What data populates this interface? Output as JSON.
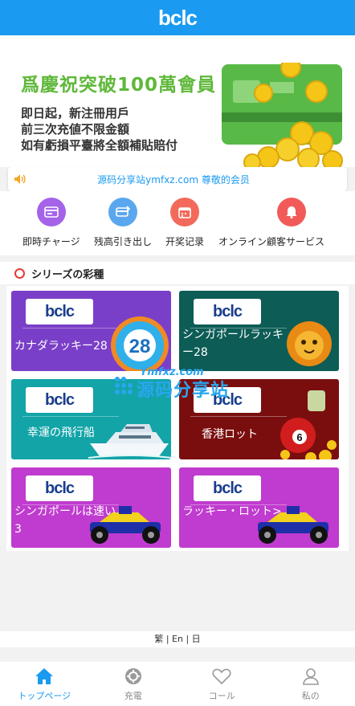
{
  "header": {
    "logo_text": "bclc"
  },
  "banner": {
    "title": "爲慶祝突破100萬會員",
    "lines": [
      "即日起，新注冊用戶",
      "前三次充値不限金額",
      "如有虧損平臺將全額補貼賠付"
    ]
  },
  "notice": {
    "text": "源码分享站ymfxz.com 尊敬的会员",
    "icon": "speaker-icon"
  },
  "quick_menu": [
    {
      "label": "即時チャージ",
      "icon": "wallet-icon",
      "color": "#a463e8"
    },
    {
      "label": "残高引き出し",
      "icon": "withdraw-card-icon",
      "color": "#5aa7ef"
    },
    {
      "label": "开奖记录",
      "icon": "calendar-icon",
      "color": "#f26a5b"
    },
    {
      "label": "オンライン顧客サービス",
      "icon": "bell-icon",
      "color": "#f25a5a"
    }
  ],
  "section": {
    "title": "シリーズの彩種"
  },
  "games": [
    {
      "name": "カナダラッキー28",
      "bg": "#7a3fc8",
      "art": "ball-28"
    },
    {
      "name": "シンガポールラッキー28",
      "bg": "#0d5c56",
      "art": "lion"
    },
    {
      "name": "幸運の飛行船",
      "bg": "#13a4a8",
      "art": "yacht"
    },
    {
      "name": "香港ロット",
      "bg": "#7a0e0e",
      "art": "ball-6"
    },
    {
      "name": "シンガポールは速い 3",
      "bg": "#c03bcf",
      "art": "racecar"
    },
    {
      "name": "ラッキー・ロット>",
      "bg": "#c03bcf",
      "art": "racecar"
    }
  ],
  "watermark": {
    "top": "Ymfxz.com",
    "main": "源码分享站"
  },
  "language": {
    "text": "繁 | En | 日"
  },
  "tabbar": [
    {
      "label": "トップページ",
      "icon": "home-icon",
      "active": true
    },
    {
      "label": "充電",
      "icon": "recharge-icon",
      "active": false
    },
    {
      "label": "コール",
      "icon": "heart-icon",
      "active": false
    },
    {
      "label": "私の",
      "icon": "user-icon",
      "active": false
    }
  ],
  "colors": {
    "brand_blue": "#1a9af0",
    "banner_green": "#5fb83a"
  }
}
